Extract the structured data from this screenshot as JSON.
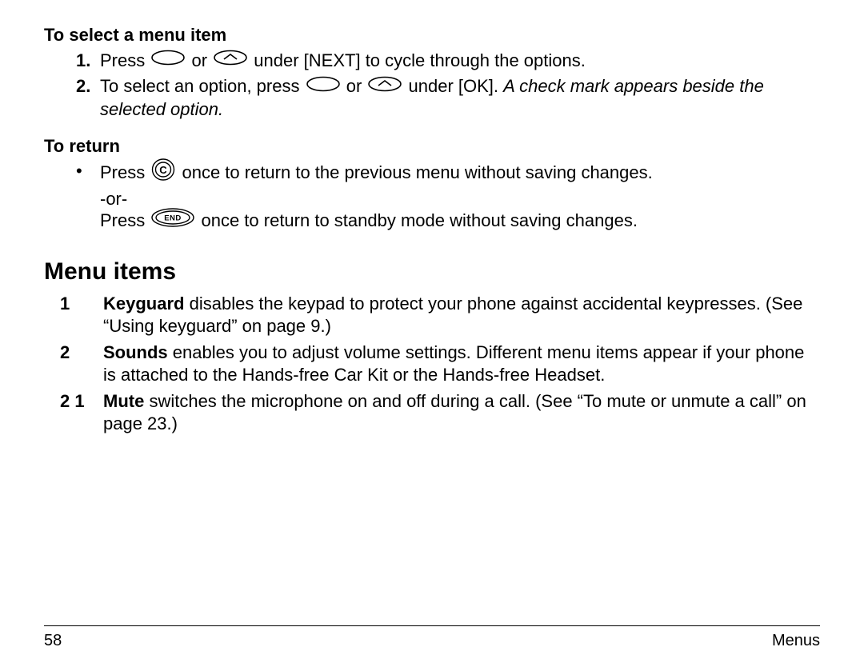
{
  "headings": {
    "select": "To select a menu item",
    "return": "To return",
    "menu_items": "Menu items"
  },
  "select_steps": {
    "s1_num": "1.",
    "s1_a": "Press ",
    "s1_b": " or ",
    "s1_c": " under [NEXT] to cycle through the options.",
    "s2_num": "2.",
    "s2_a": "To select an option, press ",
    "s2_b": " or ",
    "s2_c": " under [OK]. ",
    "s2_italic": "A check mark appears beside the selected option."
  },
  "return_steps": {
    "bullet": "•",
    "r1_a": "Press ",
    "r1_b": " once to return to the previous menu without saving changes.",
    "or": "-or-",
    "r2_a": "Press ",
    "r2_b": " once to return to standby mode without saving changes."
  },
  "menu_items": {
    "m1_code": "1",
    "m1_bold": "Keyguard",
    "m1_text": " disables the keypad to protect your phone against accidental keypresses. (See “Using keyguard” on page 9.)",
    "m2_code": "2",
    "m2_bold": "Sounds",
    "m2_text": " enables you to adjust volume settings. Different menu items appear if your phone is attached to the Hands-free Car Kit or the Hands-free Headset.",
    "m3_code": "2 1",
    "m3_bold": "Mute",
    "m3_text": " switches the microphone on and off during a call. (See “To mute or unmute a call” on page 23.)"
  },
  "footer": {
    "page": "58",
    "section": "Menus"
  }
}
